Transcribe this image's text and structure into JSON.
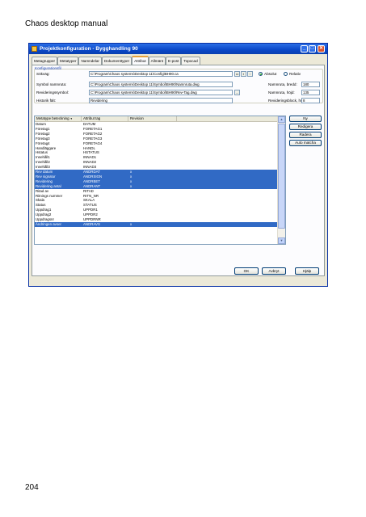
{
  "document": {
    "header": "Chaos desktop manual",
    "page_number": "204"
  },
  "window": {
    "title": "Projektkonfiguration - Bygghandling 90",
    "controls": {
      "minimize": "_",
      "maximize": "□",
      "close": "✕"
    }
  },
  "tabs": [
    "Metagrupper",
    "Metatyper",
    "Namndelar",
    "Dokumenttyper",
    "Attribut",
    "Allmänt",
    "E-post",
    "Topocad"
  ],
  "active_tab": "Attribut",
  "config": {
    "legend": "Konfigurationsfil",
    "sokvag_label": "Sökväg:",
    "sokvag_value": "C:\\Program\\Chaos systems\\Desktop 11\\Config\\BH90.ca",
    "radio_absolut": "Absolut",
    "radio_relativ": "Relativ",
    "symbol_label": "Symbol namnruta:",
    "symbol_value": "C:\\Program\\Chaos systems\\Desktop 11\\Symbol\\BH90\\Namnruta.dwg",
    "revsymbol_label": "Revideringssymbol:",
    "revsymbol_value": "C:\\Program\\Chaos systems\\Desktop 11\\Symbol\\BH90\\Rev-Tag.dwg",
    "historik_label": "Historik fält:",
    "historik_value": "Revidering",
    "bredd_label": "Namnruta, bredd:",
    "bredd_value": "180",
    "hojd_label": "Namnruta, höjd:",
    "hojd_value": "135",
    "revblock_label": "Revideringsblock, höjd:",
    "revblock_value": "8"
  },
  "list": {
    "headers": [
      "Metatype beteckning",
      "Attribut tag",
      "Revision"
    ],
    "sort_indicator": "▼",
    "rows": [
      {
        "name": "Datum",
        "tag": "DATUM",
        "rev": "",
        "selected": false
      },
      {
        "name": "Företag1",
        "tag": "FORETAG1",
        "rev": "",
        "selected": false
      },
      {
        "name": "Företag2",
        "tag": "FORETAG2",
        "rev": "",
        "selected": false
      },
      {
        "name": "Företag3",
        "tag": "FORETAG3",
        "rev": "",
        "selected": false
      },
      {
        "name": "Företag4",
        "tag": "FORETAG4",
        "rev": "",
        "selected": false
      },
      {
        "name": "Handläggare",
        "tag": "HANDL",
        "rev": "",
        "selected": false
      },
      {
        "name": "Hstatus",
        "tag": "HSTATUS",
        "rev": "",
        "selected": false
      },
      {
        "name": "Innehåll1",
        "tag": "INNAD1",
        "rev": "",
        "selected": false
      },
      {
        "name": "Innehåll2",
        "tag": "INNAD2",
        "rev": "",
        "selected": false
      },
      {
        "name": "Innehåll3",
        "tag": "INNAD3",
        "rev": "",
        "selected": false
      },
      {
        "name": "Rev datum",
        "tag": "ANDRDAT",
        "rev": "x",
        "selected": true
      },
      {
        "name": "Rev signatur",
        "tag": "ANDRSIGN",
        "rev": "x",
        "selected": true
      },
      {
        "name": "Revidering",
        "tag": "ANDRBET",
        "rev": "x",
        "selected": true
      },
      {
        "name": "Revidering antal",
        "tag": "ANDRANT",
        "rev": "x",
        "selected": true
      },
      {
        "name": "Ritad av",
        "tag": "RITAD",
        "rev": "",
        "selected": false
      },
      {
        "name": "Ritnings nummer",
        "tag": "RITN_NR",
        "rev": "",
        "selected": false
      },
      {
        "name": "Skala",
        "tag": "SKALA",
        "rev": "",
        "selected": false
      },
      {
        "name": "Status",
        "tag": "STATUS",
        "rev": "",
        "selected": false
      },
      {
        "name": "Uppdrag1",
        "tag": "UPPDR1",
        "rev": "",
        "selected": false
      },
      {
        "name": "Uppdrag2",
        "tag": "UPPDR2",
        "rev": "",
        "selected": false
      },
      {
        "name": "Uppdragsnr",
        "tag": "UPPDRNR",
        "rev": "",
        "selected": false
      },
      {
        "name": "Ändringen avser",
        "tag": "ANDRAVS",
        "rev": "x",
        "selected": true
      }
    ]
  },
  "side_buttons": [
    "Ny",
    "Redigera",
    "Radera",
    "Auto matcha"
  ],
  "bottom_buttons": [
    "OK",
    "Avbryt",
    "Hjälp"
  ],
  "icons": [
    "folder-open-icon",
    "save-icon",
    "copy-icon",
    "browse-icon",
    "scroll-up-icon",
    "scroll-down-icon"
  ]
}
